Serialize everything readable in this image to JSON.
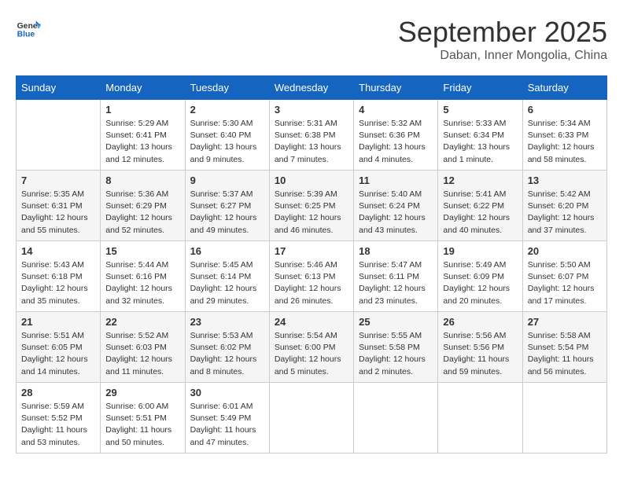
{
  "logo": {
    "text_general": "General",
    "text_blue": "Blue"
  },
  "title": "September 2025",
  "location": "Daban, Inner Mongolia, China",
  "days_of_week": [
    "Sunday",
    "Monday",
    "Tuesday",
    "Wednesday",
    "Thursday",
    "Friday",
    "Saturday"
  ],
  "weeks": [
    [
      {
        "day": "",
        "info": ""
      },
      {
        "day": "1",
        "info": "Sunrise: 5:29 AM\nSunset: 6:41 PM\nDaylight: 13 hours\nand 12 minutes."
      },
      {
        "day": "2",
        "info": "Sunrise: 5:30 AM\nSunset: 6:40 PM\nDaylight: 13 hours\nand 9 minutes."
      },
      {
        "day": "3",
        "info": "Sunrise: 5:31 AM\nSunset: 6:38 PM\nDaylight: 13 hours\nand 7 minutes."
      },
      {
        "day": "4",
        "info": "Sunrise: 5:32 AM\nSunset: 6:36 PM\nDaylight: 13 hours\nand 4 minutes."
      },
      {
        "day": "5",
        "info": "Sunrise: 5:33 AM\nSunset: 6:34 PM\nDaylight: 13 hours\nand 1 minute."
      },
      {
        "day": "6",
        "info": "Sunrise: 5:34 AM\nSunset: 6:33 PM\nDaylight: 12 hours\nand 58 minutes."
      }
    ],
    [
      {
        "day": "7",
        "info": "Sunrise: 5:35 AM\nSunset: 6:31 PM\nDaylight: 12 hours\nand 55 minutes."
      },
      {
        "day": "8",
        "info": "Sunrise: 5:36 AM\nSunset: 6:29 PM\nDaylight: 12 hours\nand 52 minutes."
      },
      {
        "day": "9",
        "info": "Sunrise: 5:37 AM\nSunset: 6:27 PM\nDaylight: 12 hours\nand 49 minutes."
      },
      {
        "day": "10",
        "info": "Sunrise: 5:39 AM\nSunset: 6:25 PM\nDaylight: 12 hours\nand 46 minutes."
      },
      {
        "day": "11",
        "info": "Sunrise: 5:40 AM\nSunset: 6:24 PM\nDaylight: 12 hours\nand 43 minutes."
      },
      {
        "day": "12",
        "info": "Sunrise: 5:41 AM\nSunset: 6:22 PM\nDaylight: 12 hours\nand 40 minutes."
      },
      {
        "day": "13",
        "info": "Sunrise: 5:42 AM\nSunset: 6:20 PM\nDaylight: 12 hours\nand 37 minutes."
      }
    ],
    [
      {
        "day": "14",
        "info": "Sunrise: 5:43 AM\nSunset: 6:18 PM\nDaylight: 12 hours\nand 35 minutes."
      },
      {
        "day": "15",
        "info": "Sunrise: 5:44 AM\nSunset: 6:16 PM\nDaylight: 12 hours\nand 32 minutes."
      },
      {
        "day": "16",
        "info": "Sunrise: 5:45 AM\nSunset: 6:14 PM\nDaylight: 12 hours\nand 29 minutes."
      },
      {
        "day": "17",
        "info": "Sunrise: 5:46 AM\nSunset: 6:13 PM\nDaylight: 12 hours\nand 26 minutes."
      },
      {
        "day": "18",
        "info": "Sunrise: 5:47 AM\nSunset: 6:11 PM\nDaylight: 12 hours\nand 23 minutes."
      },
      {
        "day": "19",
        "info": "Sunrise: 5:49 AM\nSunset: 6:09 PM\nDaylight: 12 hours\nand 20 minutes."
      },
      {
        "day": "20",
        "info": "Sunrise: 5:50 AM\nSunset: 6:07 PM\nDaylight: 12 hours\nand 17 minutes."
      }
    ],
    [
      {
        "day": "21",
        "info": "Sunrise: 5:51 AM\nSunset: 6:05 PM\nDaylight: 12 hours\nand 14 minutes."
      },
      {
        "day": "22",
        "info": "Sunrise: 5:52 AM\nSunset: 6:03 PM\nDaylight: 12 hours\nand 11 minutes."
      },
      {
        "day": "23",
        "info": "Sunrise: 5:53 AM\nSunset: 6:02 PM\nDaylight: 12 hours\nand 8 minutes."
      },
      {
        "day": "24",
        "info": "Sunrise: 5:54 AM\nSunset: 6:00 PM\nDaylight: 12 hours\nand 5 minutes."
      },
      {
        "day": "25",
        "info": "Sunrise: 5:55 AM\nSunset: 5:58 PM\nDaylight: 12 hours\nand 2 minutes."
      },
      {
        "day": "26",
        "info": "Sunrise: 5:56 AM\nSunset: 5:56 PM\nDaylight: 11 hours\nand 59 minutes."
      },
      {
        "day": "27",
        "info": "Sunrise: 5:58 AM\nSunset: 5:54 PM\nDaylight: 11 hours\nand 56 minutes."
      }
    ],
    [
      {
        "day": "28",
        "info": "Sunrise: 5:59 AM\nSunset: 5:52 PM\nDaylight: 11 hours\nand 53 minutes."
      },
      {
        "day": "29",
        "info": "Sunrise: 6:00 AM\nSunset: 5:51 PM\nDaylight: 11 hours\nand 50 minutes."
      },
      {
        "day": "30",
        "info": "Sunrise: 6:01 AM\nSunset: 5:49 PM\nDaylight: 11 hours\nand 47 minutes."
      },
      {
        "day": "",
        "info": ""
      },
      {
        "day": "",
        "info": ""
      },
      {
        "day": "",
        "info": ""
      },
      {
        "day": "",
        "info": ""
      }
    ]
  ]
}
